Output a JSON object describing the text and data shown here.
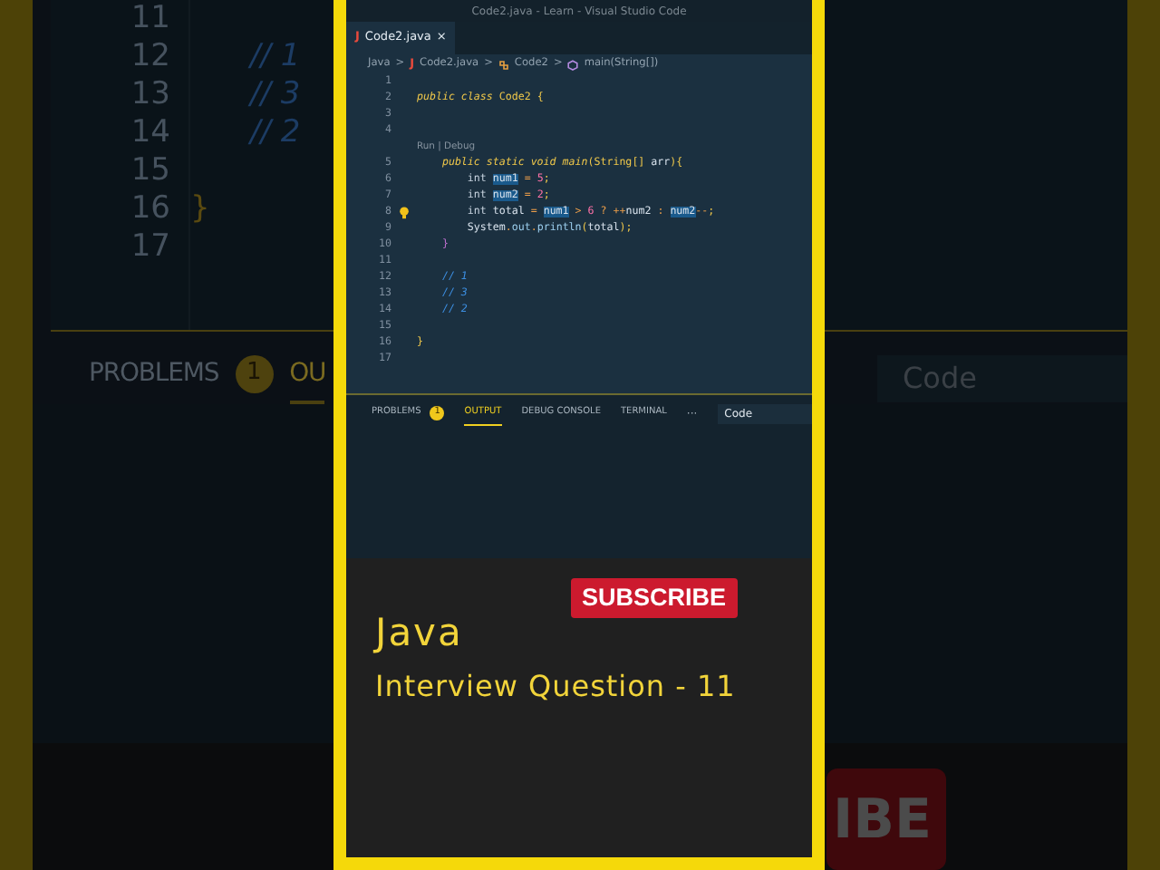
{
  "background": {
    "line_numbers": [
      "11",
      "12",
      "13",
      "14",
      "15",
      "16",
      "17"
    ],
    "rows": [
      {
        "text": ""
      },
      {
        "text": "// 1",
        "kind": "comment"
      },
      {
        "text": "// 3",
        "kind": "comment"
      },
      {
        "text": "// 2",
        "kind": "comment"
      },
      {
        "text": ""
      },
      {
        "text": "}",
        "kind": "brace"
      },
      {
        "text": ""
      }
    ],
    "panel_tabs": [
      {
        "label": "PROBLEMS",
        "badge": "1",
        "selected": false
      },
      {
        "label": "OU",
        "selected": true
      }
    ],
    "filter": "Code",
    "subscribe_fragment": "IBE"
  },
  "window": {
    "title": "Code2.java - Learn - Visual Studio Code"
  },
  "tabs": [
    {
      "icon": "J",
      "label": "Code2.java",
      "close": "×",
      "selected": true
    }
  ],
  "breadcrumb": [
    {
      "label": "Java",
      "kind": "text"
    },
    {
      "label": "Code2.java",
      "kind": "file",
      "icon": "J"
    },
    {
      "label": "Code2",
      "kind": "class"
    },
    {
      "label": "main(String[])",
      "kind": "method"
    }
  ],
  "breadcrumb_separator": ">",
  "editor": {
    "lines": [
      {
        "number": "1"
      },
      {
        "number": "2",
        "tokens": [
          {
            "text": "public class ",
            "kind": "keyword"
          },
          {
            "text": "Code2 ",
            "kind": "classname"
          },
          {
            "text": "{",
            "kind": "punct"
          }
        ]
      },
      {
        "number": "3"
      },
      {
        "number": "4"
      },
      {
        "kind": "codelens",
        "text": "Run | Debug"
      },
      {
        "number": "5",
        "tokens": [
          {
            "text": "    public static void main",
            "kind": "keyword"
          },
          {
            "text": "(",
            "kind": "punct"
          },
          {
            "text": "String",
            "kind": "classname"
          },
          {
            "text": "[] ",
            "kind": "punct"
          },
          {
            "text": "arr",
            "kind": "name"
          },
          {
            "text": "){",
            "kind": "punct"
          }
        ]
      },
      {
        "number": "6",
        "tokens": [
          {
            "text": "        int ",
            "kind": "type"
          },
          {
            "text": "num1",
            "kind": "name",
            "highlight": true
          },
          {
            "text": " = ",
            "kind": "operator"
          },
          {
            "text": "5",
            "kind": "number"
          },
          {
            "text": ";",
            "kind": "punct"
          }
        ]
      },
      {
        "number": "7",
        "tokens": [
          {
            "text": "        int ",
            "kind": "type"
          },
          {
            "text": "num2",
            "kind": "name",
            "highlight": true
          },
          {
            "text": " = ",
            "kind": "operator"
          },
          {
            "text": "2",
            "kind": "number"
          },
          {
            "text": ";",
            "kind": "punct"
          }
        ]
      },
      {
        "number": "8",
        "lightbulb": true,
        "tokens": [
          {
            "text": "        int ",
            "kind": "type"
          },
          {
            "text": "total",
            "kind": "name"
          },
          {
            "text": " = ",
            "kind": "operator"
          },
          {
            "text": "num1",
            "kind": "name",
            "highlight": true
          },
          {
            "text": " > ",
            "kind": "operator"
          },
          {
            "text": "6",
            "kind": "number"
          },
          {
            "text": " ? ++",
            "kind": "operator"
          },
          {
            "text": "num2",
            "kind": "name"
          },
          {
            "text": " : ",
            "kind": "operator"
          },
          {
            "text": "num2",
            "kind": "name",
            "highlight": true
          },
          {
            "text": "--",
            "kind": "operator"
          },
          {
            "text": ";",
            "kind": "punct"
          }
        ]
      },
      {
        "number": "9",
        "tokens": [
          {
            "text": "        System",
            "kind": "name"
          },
          {
            "text": ".",
            "kind": "operator"
          },
          {
            "text": "out",
            "kind": "function"
          },
          {
            "text": ".",
            "kind": "operator"
          },
          {
            "text": "println",
            "kind": "function"
          },
          {
            "text": "(",
            "kind": "punct"
          },
          {
            "text": "total",
            "kind": "name"
          },
          {
            "text": ");",
            "kind": "punct"
          }
        ]
      },
      {
        "number": "10",
        "tokens": [
          {
            "text": "    }",
            "kind": "brace"
          }
        ]
      },
      {
        "number": "11"
      },
      {
        "number": "12",
        "tokens": [
          {
            "text": "    // 1",
            "kind": "comment"
          }
        ]
      },
      {
        "number": "13",
        "tokens": [
          {
            "text": "    // 3",
            "kind": "comment"
          }
        ]
      },
      {
        "number": "14",
        "tokens": [
          {
            "text": "    // 2",
            "kind": "comment"
          }
        ]
      },
      {
        "number": "15"
      },
      {
        "number": "16",
        "tokens": [
          {
            "text": "}",
            "kind": "punct"
          }
        ]
      },
      {
        "number": "17"
      }
    ]
  },
  "panel": {
    "tabs": [
      {
        "label": "PROBLEMS",
        "badge": "1",
        "selected": false
      },
      {
        "label": "OUTPUT",
        "selected": true
      },
      {
        "label": "DEBUG CONSOLE",
        "selected": false
      },
      {
        "label": "TERMINAL",
        "selected": false
      }
    ],
    "more": "···",
    "filter": "Code"
  },
  "promo": {
    "subscribe": "SUBSCRIBE",
    "title": "Java",
    "subtitle": "Interview Question - 11"
  }
}
